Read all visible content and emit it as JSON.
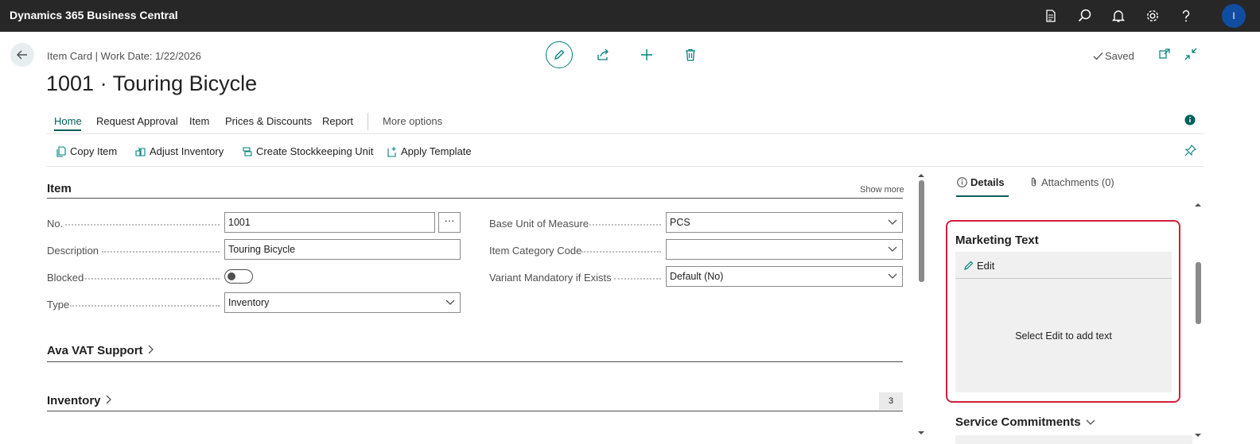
{
  "app": {
    "brand": "Dynamics 365 Business Central",
    "avatar_initial": "I",
    "top_icons": [
      "document-icon",
      "search-icon",
      "bell-icon",
      "gear-icon",
      "help-icon"
    ]
  },
  "header": {
    "breadcrumb": "Item Card | Work Date: 1/22/2026",
    "title": "1001 · Touring Bicycle",
    "saved_label": "Saved"
  },
  "tabs": [
    "Home",
    "Request Approval",
    "Item",
    "Prices & Discounts",
    "Report",
    "More options"
  ],
  "actions": [
    "Copy Item",
    "Adjust Inventory",
    "Create Stockkeeping Unit",
    "Apply Template"
  ],
  "item_section": {
    "title": "Item",
    "show_more": "Show more",
    "left_fields": [
      {
        "label": "No.",
        "value": "1001"
      },
      {
        "label": "Description",
        "value": "Touring Bicycle"
      },
      {
        "label": "Blocked",
        "value": ""
      },
      {
        "label": "Type",
        "value": "Inventory"
      }
    ],
    "right_fields": [
      {
        "label": "Base Unit of Measure",
        "value": "PCS"
      },
      {
        "label": "Item Category Code",
        "value": ""
      },
      {
        "label": "Variant Mandatory if Exists",
        "value": "Default (No)"
      }
    ],
    "blocked_on": false
  },
  "sections": {
    "ava_vat": "Ava VAT Support",
    "inventory": "Inventory",
    "inventory_count": "3"
  },
  "factbox": {
    "tabs": [
      "Details",
      "Attachments (0)"
    ],
    "marketing_title": "Marketing Text",
    "edit_label": "Edit",
    "hint": "Select Edit to add text",
    "service_title": "Service Commitments"
  },
  "colors": {
    "accent": "#005f5c",
    "topbar": "#272727",
    "highlight": "#d21f3c"
  }
}
